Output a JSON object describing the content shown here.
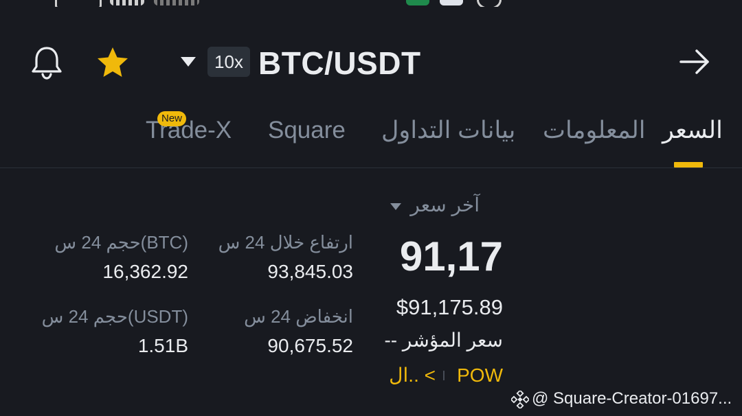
{
  "header": {
    "leverage": "10x",
    "pair": "BTC/USDT"
  },
  "tabs": [
    {
      "label": "السعر",
      "active": true
    },
    {
      "label": "المعلومات",
      "active": false
    },
    {
      "label": "بيانات التداول",
      "active": false
    },
    {
      "label": "Square",
      "active": false
    },
    {
      "label": "Trade-X",
      "active": false,
      "badge": "New"
    }
  ],
  "price": {
    "last_price_label": "آخر سعر",
    "last_price": "91,17",
    "usd_price": "$91,175.89",
    "index_price": "-- سعر المؤشر",
    "tags": [
      "POW",
      "ال.. <"
    ]
  },
  "stats": {
    "high_24h_label": "ارتفاع خلال 24 س",
    "high_24h": "93,845.03",
    "low_24h_label": "انخفاض 24 س",
    "low_24h": "90,675.52",
    "vol_btc_label": "حجم 24 س(BTC)",
    "vol_btc": "16,362.92",
    "vol_usdt_label": "حجم 24 س(USDT)",
    "vol_usdt": "1.51B"
  },
  "watermark": "@ Square-Creator-01697...",
  "colors": {
    "background": "#181a20",
    "accent": "#f0b90b",
    "text_primary": "#eaecef",
    "text_secondary": "#848e9c"
  },
  "icons": [
    "bell-icon",
    "star-icon",
    "caret-down-icon",
    "arrow-right-icon",
    "binance-logo-icon"
  ]
}
